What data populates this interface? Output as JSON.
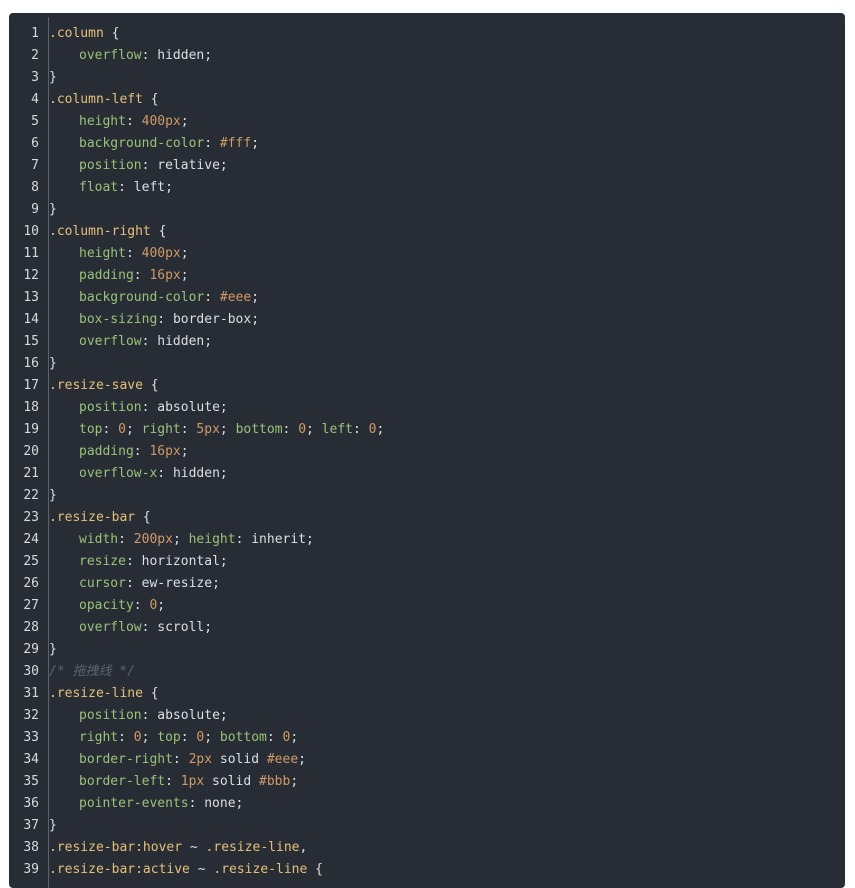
{
  "lines": [
    {
      "n": "1",
      "tokens": [
        {
          "t": ".column",
          "c": "sel"
        },
        {
          "t": " {",
          "c": "pun"
        }
      ]
    },
    {
      "n": "2",
      "indent": true,
      "tokens": [
        {
          "t": "overflow",
          "c": "prop"
        },
        {
          "t": ": ",
          "c": "pun"
        },
        {
          "t": "hidden",
          "c": "val"
        },
        {
          "t": ";",
          "c": "pun"
        }
      ]
    },
    {
      "n": "3",
      "tokens": [
        {
          "t": "}",
          "c": "pun"
        }
      ]
    },
    {
      "n": "4",
      "tokens": [
        {
          "t": ".column-left",
          "c": "sel"
        },
        {
          "t": " {",
          "c": "pun"
        }
      ]
    },
    {
      "n": "5",
      "indent": true,
      "tokens": [
        {
          "t": "height",
          "c": "prop"
        },
        {
          "t": ": ",
          "c": "pun"
        },
        {
          "t": "400px",
          "c": "num"
        },
        {
          "t": ";",
          "c": "pun"
        }
      ]
    },
    {
      "n": "6",
      "indent": true,
      "tokens": [
        {
          "t": "background-color",
          "c": "prop"
        },
        {
          "t": ": ",
          "c": "pun"
        },
        {
          "t": "#fff",
          "c": "num"
        },
        {
          "t": ";",
          "c": "pun"
        }
      ]
    },
    {
      "n": "7",
      "indent": true,
      "tokens": [
        {
          "t": "position",
          "c": "prop"
        },
        {
          "t": ": ",
          "c": "pun"
        },
        {
          "t": "relative",
          "c": "val"
        },
        {
          "t": ";",
          "c": "pun"
        }
      ]
    },
    {
      "n": "8",
      "indent": true,
      "tokens": [
        {
          "t": "float",
          "c": "prop"
        },
        {
          "t": ": ",
          "c": "pun"
        },
        {
          "t": "left",
          "c": "val"
        },
        {
          "t": ";",
          "c": "pun"
        }
      ]
    },
    {
      "n": "9",
      "tokens": [
        {
          "t": "}",
          "c": "pun"
        }
      ]
    },
    {
      "n": "10",
      "tokens": [
        {
          "t": ".column-right",
          "c": "sel"
        },
        {
          "t": " {",
          "c": "pun"
        }
      ]
    },
    {
      "n": "11",
      "indent": true,
      "tokens": [
        {
          "t": "height",
          "c": "prop"
        },
        {
          "t": ": ",
          "c": "pun"
        },
        {
          "t": "400px",
          "c": "num"
        },
        {
          "t": ";",
          "c": "pun"
        }
      ]
    },
    {
      "n": "12",
      "indent": true,
      "tokens": [
        {
          "t": "padding",
          "c": "prop"
        },
        {
          "t": ": ",
          "c": "pun"
        },
        {
          "t": "16px",
          "c": "num"
        },
        {
          "t": ";",
          "c": "pun"
        }
      ]
    },
    {
      "n": "13",
      "indent": true,
      "tokens": [
        {
          "t": "background-color",
          "c": "prop"
        },
        {
          "t": ": ",
          "c": "pun"
        },
        {
          "t": "#eee",
          "c": "num"
        },
        {
          "t": ";",
          "c": "pun"
        }
      ]
    },
    {
      "n": "14",
      "indent": true,
      "tokens": [
        {
          "t": "box-sizing",
          "c": "prop"
        },
        {
          "t": ": ",
          "c": "pun"
        },
        {
          "t": "border-box",
          "c": "val"
        },
        {
          "t": ";",
          "c": "pun"
        }
      ]
    },
    {
      "n": "15",
      "indent": true,
      "tokens": [
        {
          "t": "overflow",
          "c": "prop"
        },
        {
          "t": ": ",
          "c": "pun"
        },
        {
          "t": "hidden",
          "c": "val"
        },
        {
          "t": ";",
          "c": "pun"
        }
      ]
    },
    {
      "n": "16",
      "tokens": [
        {
          "t": "}",
          "c": "pun"
        }
      ]
    },
    {
      "n": "17",
      "tokens": [
        {
          "t": ".resize-save",
          "c": "sel"
        },
        {
          "t": " {",
          "c": "pun"
        }
      ]
    },
    {
      "n": "18",
      "indent": true,
      "tokens": [
        {
          "t": "position",
          "c": "prop"
        },
        {
          "t": ": ",
          "c": "pun"
        },
        {
          "t": "absolute",
          "c": "val"
        },
        {
          "t": ";",
          "c": "pun"
        }
      ]
    },
    {
      "n": "19",
      "indent": true,
      "tokens": [
        {
          "t": "top",
          "c": "prop"
        },
        {
          "t": ": ",
          "c": "pun"
        },
        {
          "t": "0",
          "c": "num"
        },
        {
          "t": "; ",
          "c": "pun"
        },
        {
          "t": "right",
          "c": "prop"
        },
        {
          "t": ": ",
          "c": "pun"
        },
        {
          "t": "5px",
          "c": "num"
        },
        {
          "t": "; ",
          "c": "pun"
        },
        {
          "t": "bottom",
          "c": "prop"
        },
        {
          "t": ": ",
          "c": "pun"
        },
        {
          "t": "0",
          "c": "num"
        },
        {
          "t": "; ",
          "c": "pun"
        },
        {
          "t": "left",
          "c": "prop"
        },
        {
          "t": ": ",
          "c": "pun"
        },
        {
          "t": "0",
          "c": "num"
        },
        {
          "t": ";",
          "c": "pun"
        }
      ]
    },
    {
      "n": "20",
      "indent": true,
      "tokens": [
        {
          "t": "padding",
          "c": "prop"
        },
        {
          "t": ": ",
          "c": "pun"
        },
        {
          "t": "16px",
          "c": "num"
        },
        {
          "t": ";",
          "c": "pun"
        }
      ]
    },
    {
      "n": "21",
      "indent": true,
      "tokens": [
        {
          "t": "overflow-x",
          "c": "prop"
        },
        {
          "t": ": ",
          "c": "pun"
        },
        {
          "t": "hidden",
          "c": "val"
        },
        {
          "t": ";",
          "c": "pun"
        }
      ]
    },
    {
      "n": "22",
      "tokens": [
        {
          "t": "}",
          "c": "pun"
        }
      ]
    },
    {
      "n": "23",
      "tokens": [
        {
          "t": ".resize-bar",
          "c": "sel"
        },
        {
          "t": " {",
          "c": "pun"
        }
      ]
    },
    {
      "n": "24",
      "indent": true,
      "tokens": [
        {
          "t": "width",
          "c": "prop"
        },
        {
          "t": ": ",
          "c": "pun"
        },
        {
          "t": "200px",
          "c": "num"
        },
        {
          "t": "; ",
          "c": "pun"
        },
        {
          "t": "height",
          "c": "prop"
        },
        {
          "t": ": ",
          "c": "pun"
        },
        {
          "t": "inherit",
          "c": "val"
        },
        {
          "t": ";",
          "c": "pun"
        }
      ]
    },
    {
      "n": "25",
      "indent": true,
      "tokens": [
        {
          "t": "resize",
          "c": "prop"
        },
        {
          "t": ": ",
          "c": "pun"
        },
        {
          "t": "horizontal",
          "c": "val"
        },
        {
          "t": ";",
          "c": "pun"
        }
      ]
    },
    {
      "n": "26",
      "indent": true,
      "tokens": [
        {
          "t": "cursor",
          "c": "prop"
        },
        {
          "t": ": ",
          "c": "pun"
        },
        {
          "t": "ew-resize",
          "c": "val"
        },
        {
          "t": ";",
          "c": "pun"
        }
      ]
    },
    {
      "n": "27",
      "indent": true,
      "tokens": [
        {
          "t": "opacity",
          "c": "prop"
        },
        {
          "t": ": ",
          "c": "pun"
        },
        {
          "t": "0",
          "c": "num"
        },
        {
          "t": ";",
          "c": "pun"
        }
      ]
    },
    {
      "n": "28",
      "indent": true,
      "tokens": [
        {
          "t": "overflow",
          "c": "prop"
        },
        {
          "t": ": ",
          "c": "pun"
        },
        {
          "t": "scroll",
          "c": "val"
        },
        {
          "t": ";",
          "c": "pun"
        }
      ]
    },
    {
      "n": "29",
      "tokens": [
        {
          "t": "}",
          "c": "pun"
        }
      ]
    },
    {
      "n": "30",
      "tokens": [
        {
          "t": "/* 拖拽线 */",
          "c": "com"
        }
      ]
    },
    {
      "n": "31",
      "tokens": [
        {
          "t": ".resize-line",
          "c": "sel"
        },
        {
          "t": " {",
          "c": "pun"
        }
      ]
    },
    {
      "n": "32",
      "indent": true,
      "tokens": [
        {
          "t": "position",
          "c": "prop"
        },
        {
          "t": ": ",
          "c": "pun"
        },
        {
          "t": "absolute",
          "c": "val"
        },
        {
          "t": ";",
          "c": "pun"
        }
      ]
    },
    {
      "n": "33",
      "indent": true,
      "tokens": [
        {
          "t": "right",
          "c": "prop"
        },
        {
          "t": ": ",
          "c": "pun"
        },
        {
          "t": "0",
          "c": "num"
        },
        {
          "t": "; ",
          "c": "pun"
        },
        {
          "t": "top",
          "c": "prop"
        },
        {
          "t": ": ",
          "c": "pun"
        },
        {
          "t": "0",
          "c": "num"
        },
        {
          "t": "; ",
          "c": "pun"
        },
        {
          "t": "bottom",
          "c": "prop"
        },
        {
          "t": ": ",
          "c": "pun"
        },
        {
          "t": "0",
          "c": "num"
        },
        {
          "t": ";",
          "c": "pun"
        }
      ]
    },
    {
      "n": "34",
      "indent": true,
      "tokens": [
        {
          "t": "border-right",
          "c": "prop"
        },
        {
          "t": ": ",
          "c": "pun"
        },
        {
          "t": "2px",
          "c": "num"
        },
        {
          "t": " solid ",
          "c": "val"
        },
        {
          "t": "#eee",
          "c": "num"
        },
        {
          "t": ";",
          "c": "pun"
        }
      ]
    },
    {
      "n": "35",
      "indent": true,
      "tokens": [
        {
          "t": "border-left",
          "c": "prop"
        },
        {
          "t": ": ",
          "c": "pun"
        },
        {
          "t": "1px",
          "c": "num"
        },
        {
          "t": " solid ",
          "c": "val"
        },
        {
          "t": "#bbb",
          "c": "num"
        },
        {
          "t": ";",
          "c": "pun"
        }
      ]
    },
    {
      "n": "36",
      "indent": true,
      "tokens": [
        {
          "t": "pointer-events",
          "c": "prop"
        },
        {
          "t": ": ",
          "c": "pun"
        },
        {
          "t": "none",
          "c": "val"
        },
        {
          "t": ";",
          "c": "pun"
        }
      ]
    },
    {
      "n": "37",
      "tokens": [
        {
          "t": "}",
          "c": "pun"
        }
      ]
    },
    {
      "n": "38",
      "tokens": [
        {
          "t": ".resize-bar:hover",
          "c": "sel"
        },
        {
          "t": " ~ ",
          "c": "pun"
        },
        {
          "t": ".resize-line",
          "c": "sel"
        },
        {
          "t": ",",
          "c": "pun"
        }
      ]
    },
    {
      "n": "39",
      "tokens": [
        {
          "t": ".resize-bar:active",
          "c": "sel"
        },
        {
          "t": " ~ ",
          "c": "pun"
        },
        {
          "t": ".resize-line",
          "c": "sel"
        },
        {
          "t": " {",
          "c": "pun"
        }
      ]
    }
  ],
  "colors": {
    "background": "#282c34",
    "selector": "#e5c07b",
    "property": "#98c379",
    "number": "#d19a66",
    "text": "#dcdfe4",
    "comment": "#5c6370"
  }
}
